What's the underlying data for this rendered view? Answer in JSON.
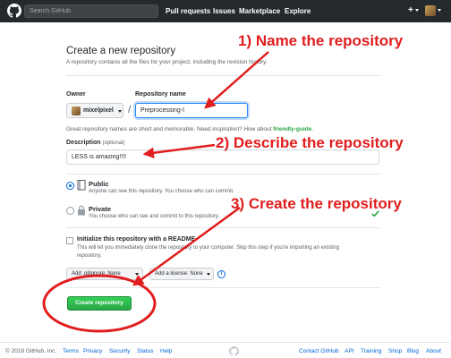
{
  "header": {
    "search_placeholder": "Search GitHub",
    "nav": [
      "Pull requests",
      "Issues",
      "Marketplace",
      "Explore"
    ],
    "plus": "+"
  },
  "form": {
    "title": "Create a new repository",
    "subtitle": "A repository contains all the files for your project, including the revision history.",
    "owner_label": "Owner",
    "owner_value": "mixelpixel",
    "slash": "/",
    "repo_label": "Repository name",
    "repo_value": "Preprocessing-I",
    "hint_prefix": "Great repository names are short and memorable. Need inspiration? How about ",
    "hint_suggestion": "friendly-guide",
    "hint_suffix": ".",
    "desc_label": "Description",
    "desc_optional": "(optional)",
    "desc_value": "LESS is amazing!!!!",
    "visibility": {
      "selected": "Public",
      "public_label": "Public",
      "public_desc": "Anyone can see this repository. You choose who can commit.",
      "private_label": "Private",
      "private_desc": "You choose who can see and commit to this repository."
    },
    "init_label": "Initialize this repository with a README",
    "init_desc_1": "This will let you immediately clone the repository to your computer. Skip this step if you're importing an existing",
    "init_desc_2": "repository.",
    "gitignore_label": "Add .gitignore: None",
    "license_label": "Add a license: None",
    "info_glyph": "i",
    "create_button": "Create repository"
  },
  "footer": {
    "copyright": "© 2018 GitHub, Inc.",
    "left_links": [
      "Terms",
      "Privacy",
      "Security",
      "Status",
      "Help"
    ],
    "right_links": [
      "Contact GitHub",
      "API",
      "Training",
      "Shop",
      "Blog",
      "About"
    ]
  },
  "annotations": {
    "step1": "1) Name the repository",
    "step2": "2) Describe the repository",
    "step3": "3) Create the repository",
    "color": "#e11d1d"
  },
  "colors": {
    "header_bg": "#24292e",
    "link": "#0366d6",
    "create_green": "#28a745"
  }
}
